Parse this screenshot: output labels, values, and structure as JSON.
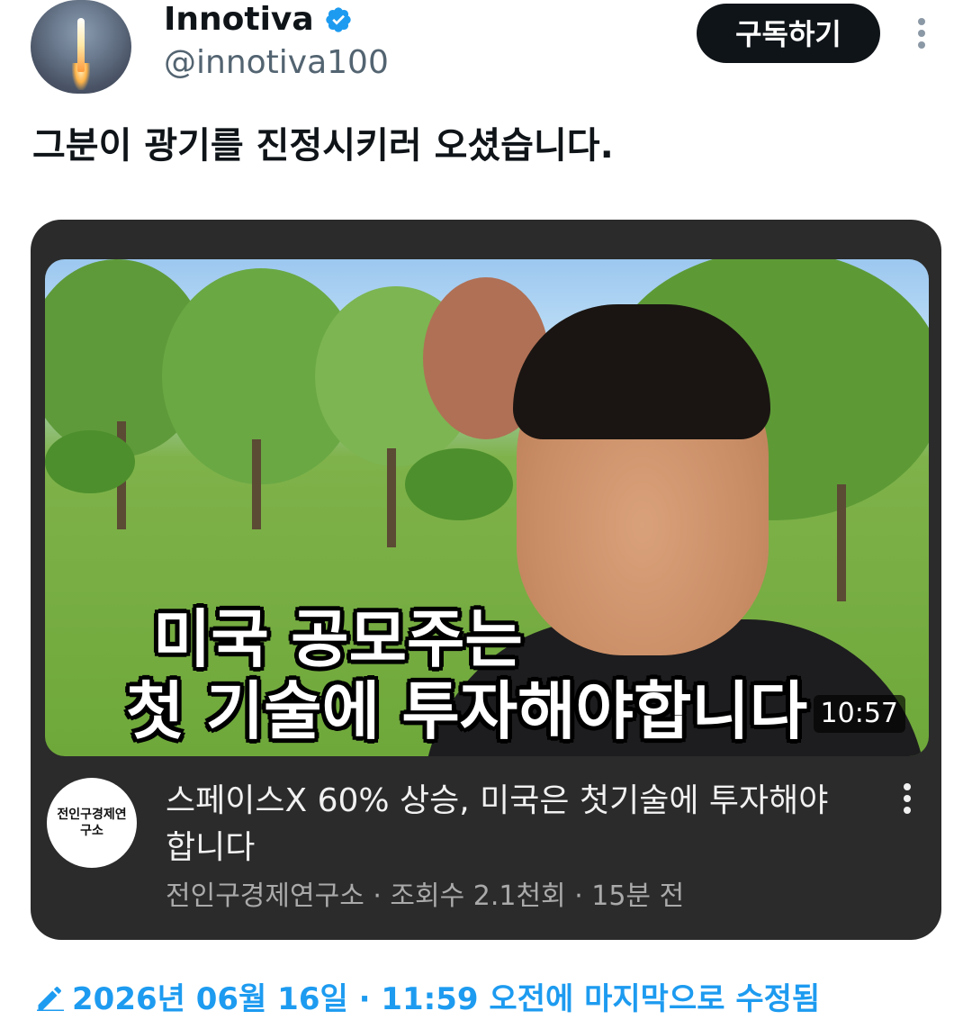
{
  "post": {
    "author_name": "Innotiva",
    "author_handle": "@innotiva100",
    "subscribe_label": "구독하기",
    "text": "그분이 광기를 진정시키러 오셨습니다.",
    "edited_label": "2026년 06월 16일 · 11:59 오전에 마지막으로 수정됨"
  },
  "video": {
    "thumbnail_caption_line1": "미국 공모주는",
    "thumbnail_caption_line2": "첫 기술에 투자해야합니다",
    "duration": "10:57",
    "title": "스페이스X  60% 상승, 미국은 첫기술에 투자해야 합니다",
    "channel_avatar_text": "전인구경제연구소",
    "meta": "전인구경제연구소 · 조회수 2.1천회 · 15분 전"
  },
  "icons": {
    "verified": "verified-badge-icon",
    "more": "more-vertical-icon",
    "edit": "pencil-icon"
  },
  "colors": {
    "accent": "#1d9bf0",
    "button_bg": "#0f1419",
    "card_bg": "#2b2b2b",
    "secondary_text": "#536471"
  }
}
